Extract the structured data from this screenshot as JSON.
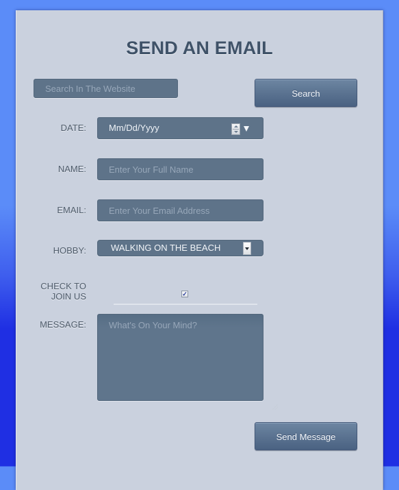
{
  "page": {
    "title": "SEND AN EMAIL"
  },
  "search": {
    "placeholder": "Search In The Website",
    "button_label": "Search"
  },
  "form": {
    "date": {
      "label": "DATE:",
      "value": "Mm/Dd/Yyyy",
      "icons": [
        "spinner-icon",
        "dropdown-arrow-icon"
      ]
    },
    "name": {
      "label": "NAME:",
      "placeholder": "Enter Your Full Name"
    },
    "email": {
      "label": "EMAIL:",
      "placeholder": "Enter Your Email Address"
    },
    "hobby": {
      "label": "HOBBY:",
      "selected": "WALKING ON THE BEACH"
    },
    "join": {
      "label_line1": "CHECK TO",
      "label_line2": "JOIN US",
      "checked": true,
      "check_glyph": "✓"
    },
    "message": {
      "label": "MESSAGE:",
      "placeholder": "What's On Your Mind?"
    },
    "submit_label": "Send Message"
  },
  "colors": {
    "background_top": "#5b8cf8",
    "background_bottom": "#1f2fe3",
    "card": "#cad1de",
    "field": "#5e7389",
    "title": "#3f5268",
    "button": "#5b7391"
  }
}
